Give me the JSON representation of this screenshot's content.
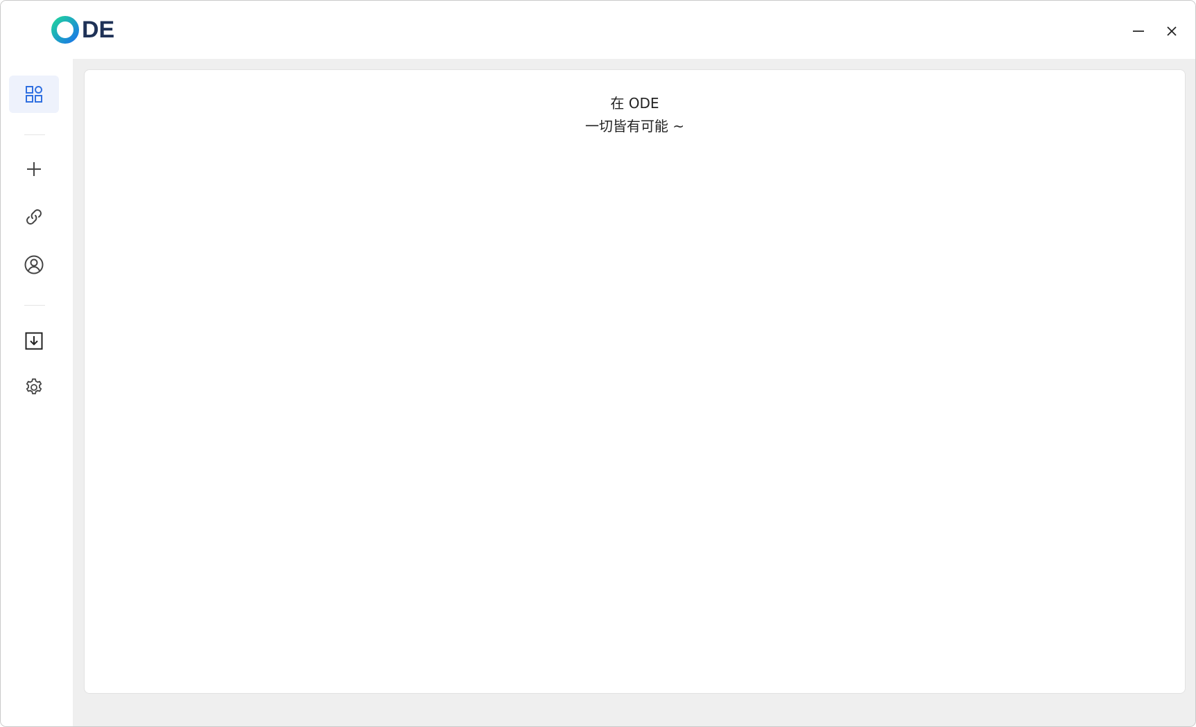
{
  "app": {
    "logo_text": "DE",
    "logo_ring_colors": [
      "#1ac6a8",
      "#1a7fe0"
    ]
  },
  "window_controls": {
    "minimize_icon": "minimize-icon",
    "close_icon": "close-icon"
  },
  "sidebar": {
    "items": [
      {
        "name": "apps",
        "icon": "grid-icon",
        "active": true
      },
      {
        "name": "add",
        "icon": "plus-icon",
        "active": false
      },
      {
        "name": "link",
        "icon": "link-icon",
        "active": false
      },
      {
        "name": "account",
        "icon": "user-circle-icon",
        "active": false
      },
      {
        "name": "download",
        "icon": "download-box-icon",
        "active": false
      },
      {
        "name": "settings",
        "icon": "gear-icon",
        "active": false
      }
    ],
    "active_color": "#2f6fe0"
  },
  "main": {
    "welcome_line1": "在 ODE",
    "welcome_line2": "一切皆有可能 ~"
  }
}
